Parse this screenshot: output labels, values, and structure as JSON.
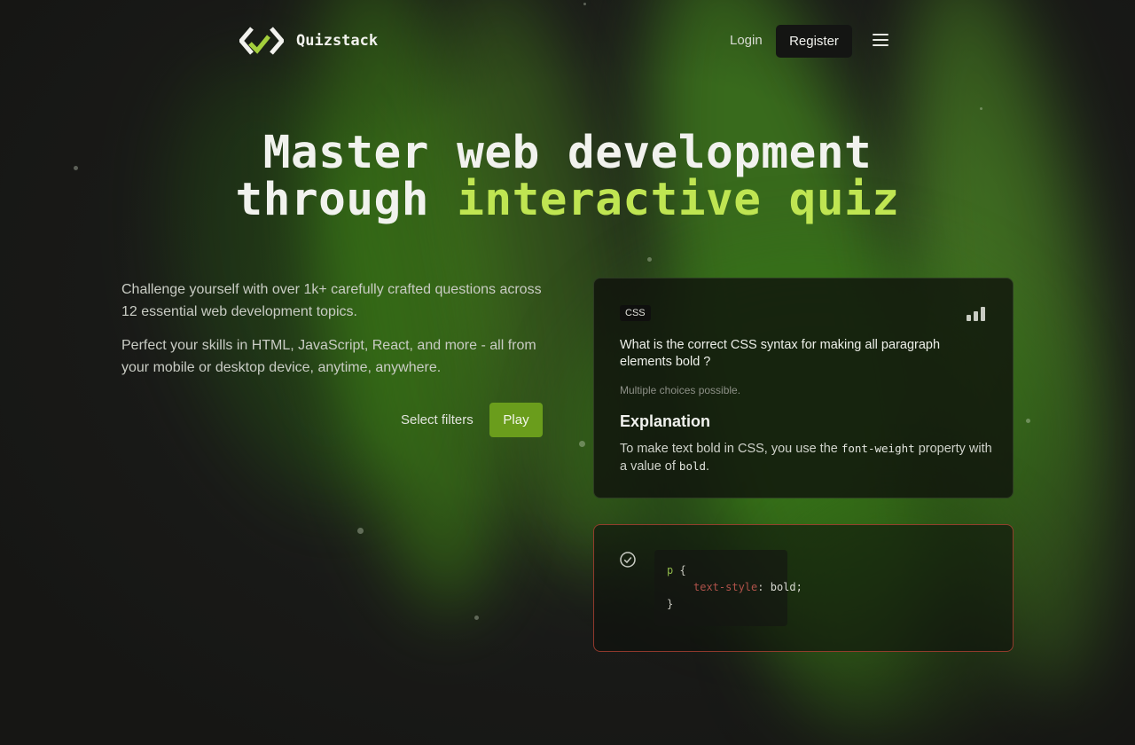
{
  "nav": {
    "brand": "Quizstack",
    "login_label": "Login",
    "register_label": "Register",
    "logo_icon": "quizstack-logo",
    "menu_icon": "hamburger-menu-icon"
  },
  "hero": {
    "line1": "Master web development",
    "line2_prefix": "through",
    "line2_accent": "interactive quiz"
  },
  "intro": {
    "paragraph1": "Challenge yourself with over 1k+ carefully crafted questions across 12 essential web development topics.",
    "paragraph2": "Perfect your skills in HTML, JavaScript, React, and more - all from your mobile or desktop device, anytime, anywhere."
  },
  "actions": {
    "filters_label": "Select filters",
    "play_label": "Play"
  },
  "quiz_card": {
    "tag": "CSS",
    "difficulty_icon": "difficulty-bars-icon",
    "question": "What is the correct CSS syntax for making all paragraph elements bold ?",
    "hint": "Multiple choices possible.",
    "explanation_title": "Explanation",
    "explanation_before": "To make text bold in CSS, you use the",
    "explanation_code1": "font-weight",
    "explanation_middle": "property with a value of",
    "explanation_code2": "bold",
    "explanation_after": "."
  },
  "answer_card": {
    "check_icon": "check-circle-icon",
    "selector": "p",
    "open_brace": "{",
    "property": "text-style",
    "separator": ":",
    "value": "bold;",
    "close_brace": "}"
  },
  "colors": {
    "accent": "#bfe552",
    "play_button": "#6a9d1c",
    "wrong_border": "#b94637",
    "background": "#1b1c1a"
  }
}
